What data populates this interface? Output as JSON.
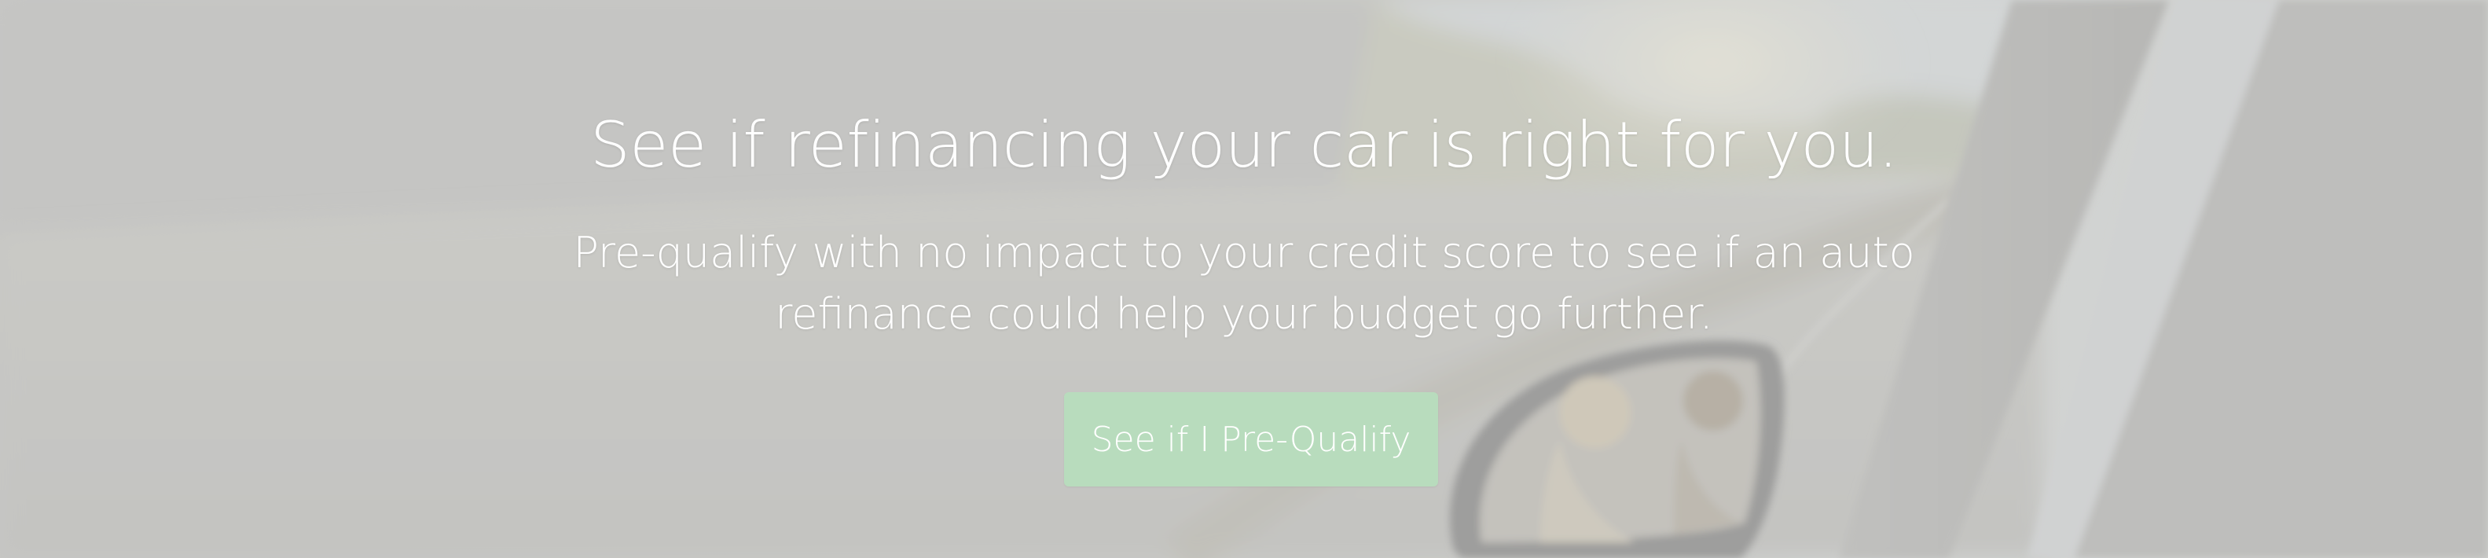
{
  "hero": {
    "title": "See if refinancing your car is right for you.",
    "subtitle": "Pre-qualify with no impact to your credit score to see if an auto refinance could help your budget go further.",
    "cta_label": "See if I Pre-Qualify"
  },
  "colors": {
    "cta_background": "#b8dcbd",
    "text": "#ffffff",
    "overlay": "#cdcdcb"
  }
}
